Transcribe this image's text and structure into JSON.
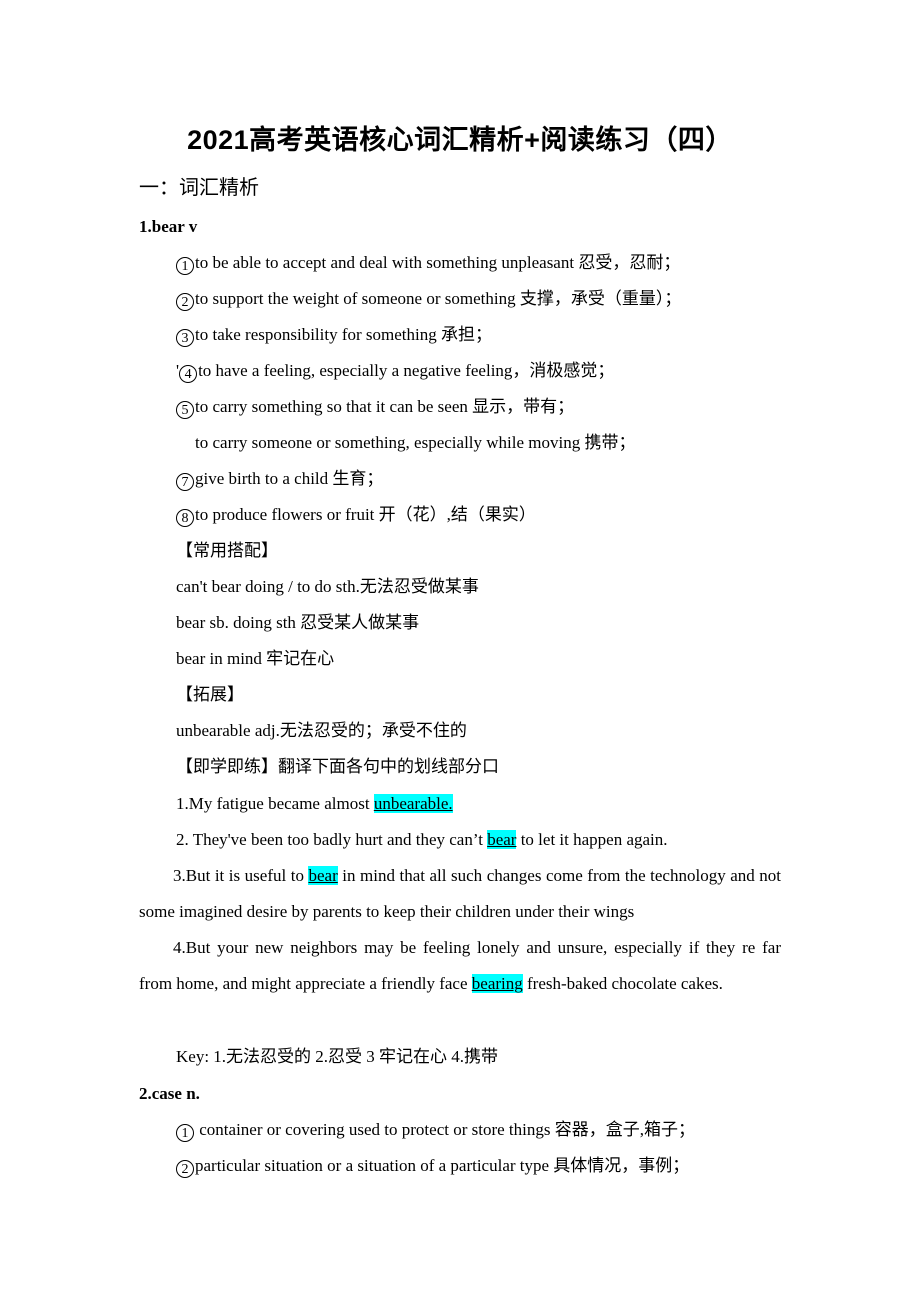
{
  "document": {
    "title": "2021高考英语核心词汇精析+阅读练习（四）",
    "section_heading": "一：词汇精析",
    "entries": [
      {
        "headword": "1.bear v",
        "senses": [
          {
            "marker": "1",
            "text": "to be able to accept and deal with something unpleasant  忍受，忍耐；"
          },
          {
            "marker": "2",
            "text": "to support the weight of someone or something  支撑，承受（重量）；"
          },
          {
            "marker": "3",
            "text": "to take responsibility for something  承担；"
          },
          {
            "prefix": "'",
            "marker": "4",
            "text": "to have a feeling, especially a negative feeling，消极感觉；"
          },
          {
            "marker": "5",
            "text": "to carry something so that it can be seen  显示，带有；"
          },
          {
            "marker": "",
            "text": "to carry someone or something, especially while moving  携带；"
          },
          {
            "marker": "7",
            "text": "give birth to a child  生育；"
          },
          {
            "marker": "8",
            "text": "to produce flowers or fruit  开（花）,结（果实）"
          }
        ],
        "collocations_heading": "【常用搭配】",
        "collocations": [
          "can't bear doing / to do sth.无法忍受做某事",
          "bear sb. doing sth 忍受某人做某事",
          "bear in mind 牢记在心"
        ],
        "extension_heading": "【拓展】",
        "extension": "unbearable adj.无法忍受的；承受不住的",
        "practice_heading": "【即学即练】翻译下面各句中的划线部分口",
        "practice": [
          {
            "before": "1.My fatigue became almost ",
            "highlight": "unbearable.",
            "after": ""
          },
          {
            "before": "2. They've been too badly hurt and they can’t ",
            "highlight": "bear",
            "after": " to let it happen again."
          },
          {
            "before": "3.But it is useful to ",
            "highlight": "bear",
            "after": " in mind that all such changes come from the technology and not some imagined desire by parents to keep their children under their wings"
          },
          {
            "before": "4.But your new neighbors may be feeling lonely and unsure, especially if they re far from home, and might appreciate a friendly face ",
            "highlight": "bearing",
            "after": " fresh-baked chocolate cakes."
          }
        ],
        "key": "Key: 1.无法忍受的  2.忍受  3 牢记在心  4.携带"
      },
      {
        "headword": "2.case n.",
        "senses": [
          {
            "marker": "1",
            "text": " container or covering used to protect or store things  容器，盒子,箱子；"
          },
          {
            "marker": "2",
            "text": "particular situation or a situation of a particular type  具体情况，事例；"
          }
        ]
      }
    ],
    "highlight_color": "#00ffff"
  }
}
